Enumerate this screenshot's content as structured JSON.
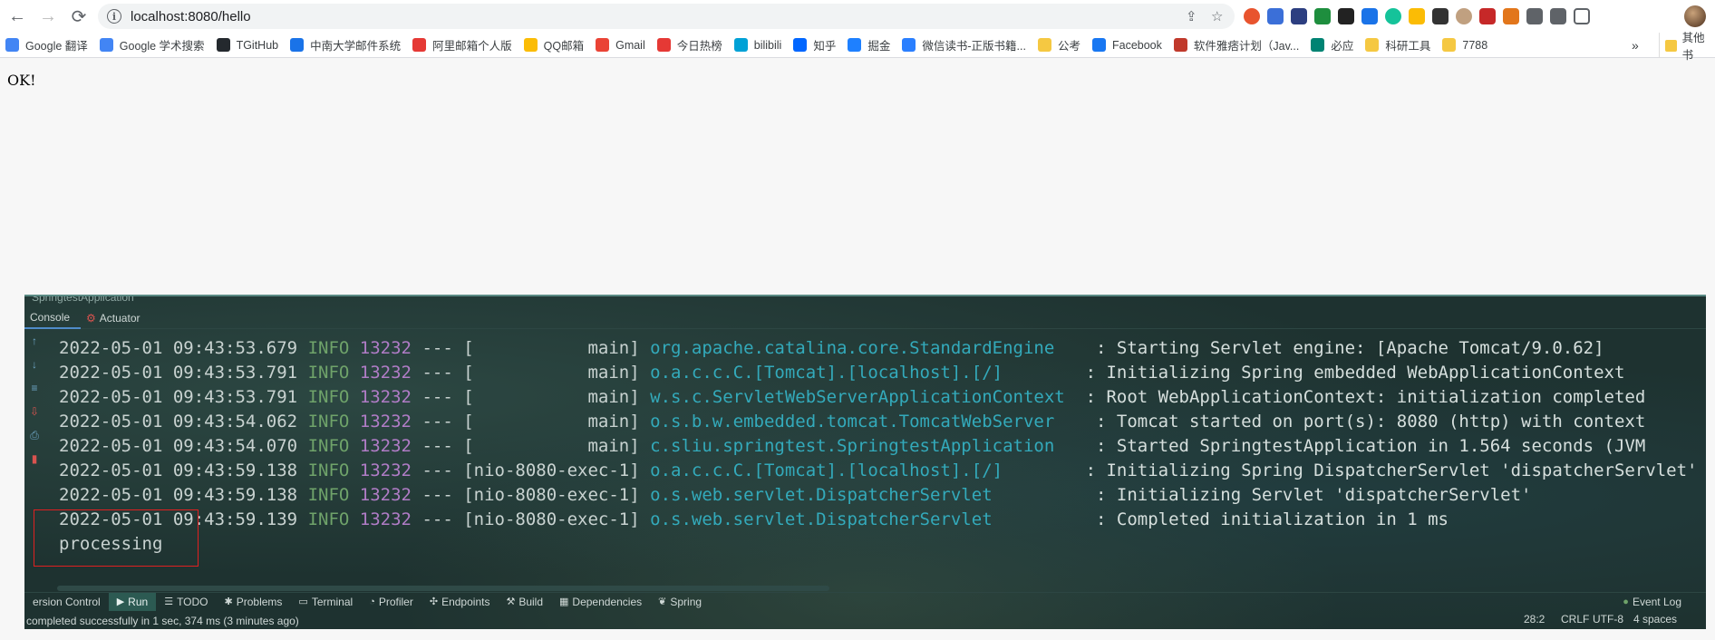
{
  "browser": {
    "url": "localhost:8080/hello",
    "nav": {
      "back": "←",
      "forward": "→",
      "reload": "⟳"
    },
    "bookmarks": [
      {
        "label": "Google 翻译",
        "color": "#4285f4"
      },
      {
        "label": "Google 学术搜索",
        "color": "#4285f4"
      },
      {
        "label": "TGitHub",
        "color": "#24292e"
      },
      {
        "label": "中南大学邮件系统",
        "color": "#1a73e8"
      },
      {
        "label": "阿里邮箱个人版",
        "color": "#e53935"
      },
      {
        "label": "QQ邮箱",
        "color": "#fbbc05"
      },
      {
        "label": "Gmail",
        "color": "#ea4335"
      },
      {
        "label": "今日热榜",
        "color": "#e53935"
      },
      {
        "label": "bilibili",
        "color": "#00a1d6"
      },
      {
        "label": "知乎",
        "color": "#0066ff"
      },
      {
        "label": "掘金",
        "color": "#1e80ff"
      },
      {
        "label": "微信读书-正版书籍...",
        "color": "#2a7fff"
      },
      {
        "label": "公考",
        "color": "#f5c842"
      },
      {
        "label": "Facebook",
        "color": "#1877f2"
      },
      {
        "label": "软件雅痞计划（Jav...",
        "color": "#c0392b"
      },
      {
        "label": "必应",
        "color": "#008373"
      },
      {
        "label": "科研工具",
        "color": "#f5c842"
      },
      {
        "label": "7788",
        "color": "#f5c842"
      }
    ],
    "more_label": "»",
    "other_label": "其他书"
  },
  "page": {
    "body_text": "OK!"
  },
  "ide": {
    "run_title": "SpringtestApplication",
    "tabs": [
      {
        "label": "Console",
        "active": true
      },
      {
        "label": "Actuator",
        "active": false
      }
    ],
    "log_lines": [
      {
        "date": "2022-05-01 09:43:53.679",
        "level": "INFO",
        "pid": "13232",
        "dash": "---",
        "thread": "[           main]",
        "logger": "org.apache.catalina.core.StandardEngine  ",
        "msg": ": Starting Servlet engine: [Apache Tomcat/9.0.62]"
      },
      {
        "date": "2022-05-01 09:43:53.791",
        "level": "INFO",
        "pid": "13232",
        "dash": "---",
        "thread": "[           main]",
        "logger": "o.a.c.c.C.[Tomcat].[localhost].[/]      ",
        "msg": ": Initializing Spring embedded WebApplicationContext"
      },
      {
        "date": "2022-05-01 09:43:53.791",
        "level": "INFO",
        "pid": "13232",
        "dash": "---",
        "thread": "[           main]",
        "logger": "w.s.c.ServletWebServerApplicationContext",
        "msg": ": Root WebApplicationContext: initialization completed"
      },
      {
        "date": "2022-05-01 09:43:54.062",
        "level": "INFO",
        "pid": "13232",
        "dash": "---",
        "thread": "[           main]",
        "logger": "o.s.b.w.embedded.tomcat.TomcatWebServer  ",
        "msg": ": Tomcat started on port(s): 8080 (http) with context"
      },
      {
        "date": "2022-05-01 09:43:54.070",
        "level": "INFO",
        "pid": "13232",
        "dash": "---",
        "thread": "[           main]",
        "logger": "c.sliu.springtest.SpringtestApplication  ",
        "msg": ": Started SpringtestApplication in 1.564 seconds (JVM"
      },
      {
        "date": "2022-05-01 09:43:59.138",
        "level": "INFO",
        "pid": "13232",
        "dash": "---",
        "thread": "[nio-8080-exec-1]",
        "logger": "o.a.c.c.C.[Tomcat].[localhost].[/]      ",
        "msg": ": Initializing Spring DispatcherServlet 'dispatcherServlet'"
      },
      {
        "date": "2022-05-01 09:43:59.138",
        "level": "INFO",
        "pid": "13232",
        "dash": "---",
        "thread": "[nio-8080-exec-1]",
        "logger": "o.s.web.servlet.DispatcherServlet        ",
        "msg": ": Initializing Servlet 'dispatcherServlet'"
      },
      {
        "date": "2022-05-01 09:43:59.139",
        "level": "INFO",
        "pid": "13232",
        "dash": "---",
        "thread": "[nio-8080-exec-1]",
        "logger": "o.s.web.servlet.DispatcherServlet        ",
        "msg": ": Completed initialization in 1 ms"
      }
    ],
    "output_line": "processing",
    "bottom_tabs": [
      {
        "label": "ersion Control",
        "icon": "",
        "active": false
      },
      {
        "label": "Run",
        "icon": "▶",
        "active": true
      },
      {
        "label": "TODO",
        "icon": "☰",
        "active": false
      },
      {
        "label": "Problems",
        "icon": "✱",
        "active": false
      },
      {
        "label": "Terminal",
        "icon": "▭",
        "active": false
      },
      {
        "label": "Profiler",
        "icon": "◔",
        "active": false
      },
      {
        "label": "Endpoints",
        "icon": "✣",
        "active": false
      },
      {
        "label": "Build",
        "icon": "⚒",
        "active": false
      },
      {
        "label": "Dependencies",
        "icon": "▦",
        "active": false
      },
      {
        "label": "Spring",
        "icon": "❦",
        "active": false
      }
    ],
    "event_log": "Event Log",
    "status_message": "completed successfully in 1 sec, 374 ms (3 minutes ago)",
    "status_right": {
      "position": "28:2",
      "line_sep": "CRLF",
      "encoding": "UTF-8",
      "indent": "4 spaces"
    }
  }
}
